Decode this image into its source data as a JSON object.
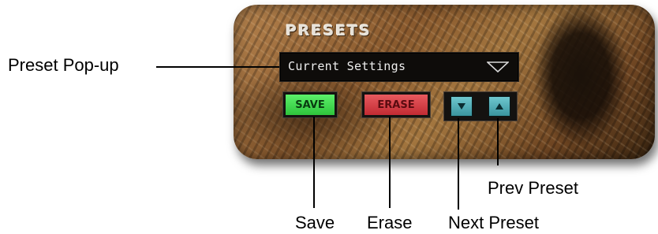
{
  "panel": {
    "title": "PRESETS",
    "preset_popup": {
      "value": "Current Settings",
      "arrow_icon": "chevron-down-icon"
    },
    "buttons": {
      "save_label": "SAVE",
      "erase_label": "ERASE"
    },
    "nav_buttons": {
      "next_icon": "down-triangle-icon",
      "prev_icon": "up-triangle-icon"
    },
    "colors": {
      "save": "#3ad84a",
      "erase": "#d8404a",
      "nav": "#55b0ba",
      "popup_bg": "#0e0c0a"
    }
  },
  "callouts": {
    "preset_popup": "Preset Pop-up",
    "save": "Save",
    "erase": "Erase",
    "next_preset": "Next Preset",
    "prev_preset": "Prev Preset"
  }
}
